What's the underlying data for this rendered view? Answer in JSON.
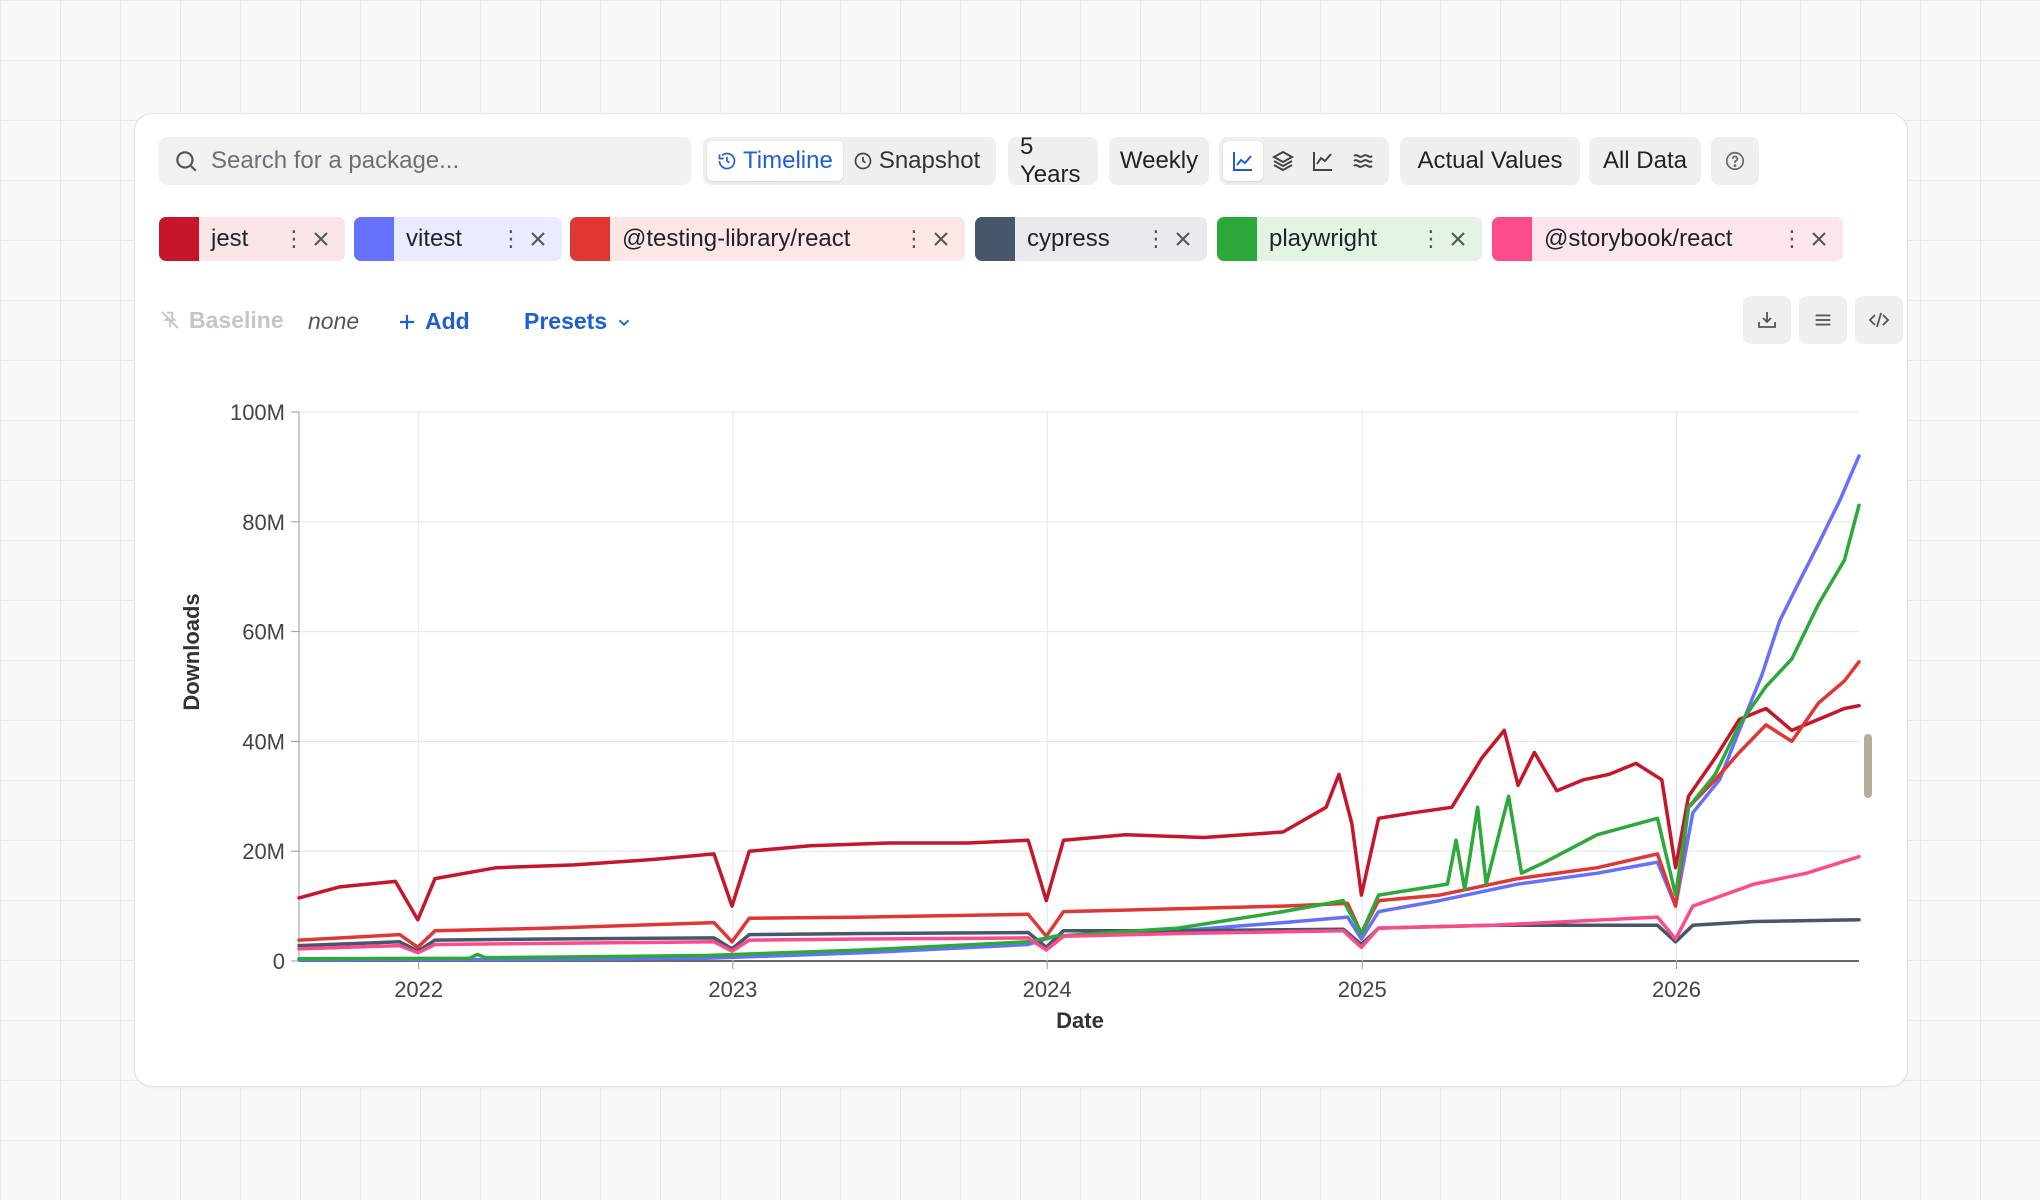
{
  "toolbar": {
    "search_placeholder": "Search for a package...",
    "view_modes": [
      "Timeline",
      "Snapshot"
    ],
    "active_view": "Timeline",
    "range": "5 Years",
    "interval": "Weekly",
    "chart_types": [
      "line-chart-icon",
      "stacked-layers-icon",
      "trend-chart-icon",
      "wave-icon"
    ],
    "active_chart_type": "line-chart-icon",
    "values_mode": "Actual Values",
    "data_mode": "All Data"
  },
  "packages": [
    {
      "name": "jest",
      "color": "#c5162a",
      "bg": "#f9e4e6"
    },
    {
      "name": "vitest",
      "color": "#6571fb",
      "bg": "#e9ebff"
    },
    {
      "name": "@testing-library/react",
      "color": "#e03634",
      "bg": "#fce6e6"
    },
    {
      "name": "cypress",
      "color": "#48566b",
      "bg": "#e8eaee"
    },
    {
      "name": "playwright",
      "color": "#2da83a",
      "bg": "#e3f4e5"
    },
    {
      "name": "@storybook/react",
      "color": "#fb4b8b",
      "bg": "#fde5ee"
    }
  ],
  "controls": {
    "baseline_label": "Baseline",
    "baseline_value": "none",
    "add_label": "Add",
    "presets_label": "Presets"
  },
  "chart_data": {
    "type": "line",
    "xlabel": "Date",
    "ylabel": "Downloads",
    "x_range": [
      "2021-08-15",
      "2026-08-01"
    ],
    "ylim": [
      0,
      100000000
    ],
    "y_ticks": [
      "0",
      "20M",
      "40M",
      "60M",
      "80M",
      "100M"
    ],
    "x_ticks": [
      "2022",
      "2023",
      "2024",
      "2025",
      "2026"
    ],
    "grid": true,
    "series": [
      {
        "name": "jest",
        "color": "#c5162a",
        "points": [
          [
            "2021-08-15",
            11.5
          ],
          [
            "2021-10-01",
            13.5
          ],
          [
            "2021-12-05",
            14.5
          ],
          [
            "2021-12-31",
            7.5
          ],
          [
            "2022-01-20",
            15
          ],
          [
            "2022-04-01",
            17
          ],
          [
            "2022-07-01",
            17.5
          ],
          [
            "2022-10-01",
            18.5
          ],
          [
            "2022-12-10",
            19.5
          ],
          [
            "2022-12-31",
            10
          ],
          [
            "2023-01-20",
            20
          ],
          [
            "2023-04-01",
            21
          ],
          [
            "2023-07-01",
            21.5
          ],
          [
            "2023-10-01",
            21.5
          ],
          [
            "2023-12-10",
            22
          ],
          [
            "2023-12-31",
            11
          ],
          [
            "2024-01-20",
            22
          ],
          [
            "2024-04-01",
            23
          ],
          [
            "2024-07-01",
            22.5
          ],
          [
            "2024-10-01",
            23.5
          ],
          [
            "2024-11-20",
            28
          ],
          [
            "2024-12-05",
            34
          ],
          [
            "2024-12-20",
            25
          ],
          [
            "2024-12-31",
            12
          ],
          [
            "2025-01-20",
            26
          ],
          [
            "2025-03-01",
            27
          ],
          [
            "2025-04-15",
            28
          ],
          [
            "2025-05-20",
            37
          ],
          [
            "2025-06-15",
            42
          ],
          [
            "2025-07-01",
            32
          ],
          [
            "2025-07-20",
            38
          ],
          [
            "2025-08-15",
            31
          ],
          [
            "2025-09-15",
            33
          ],
          [
            "2025-10-15",
            34
          ],
          [
            "2025-11-15",
            36
          ],
          [
            "2025-12-15",
            33
          ],
          [
            "2025-12-31",
            17
          ],
          [
            "2026-01-15",
            30
          ],
          [
            "2026-02-15",
            37
          ],
          [
            "2026-03-15",
            44
          ],
          [
            "2026-04-15",
            46
          ],
          [
            "2026-05-15",
            42
          ],
          [
            "2026-06-15",
            44
          ],
          [
            "2026-07-15",
            46
          ],
          [
            "2026-08-01",
            46.5
          ]
        ]
      },
      {
        "name": "vitest",
        "color": "#6571fb",
        "points": [
          [
            "2021-08-15",
            0.2
          ],
          [
            "2022-06-01",
            0.3
          ],
          [
            "2022-12-01",
            0.5
          ],
          [
            "2023-06-01",
            1.5
          ],
          [
            "2023-12-10",
            3
          ],
          [
            "2024-01-10",
            4.5
          ],
          [
            "2024-06-01",
            5.5
          ],
          [
            "2024-10-01",
            7
          ],
          [
            "2024-12-15",
            8
          ],
          [
            "2024-12-31",
            4
          ],
          [
            "2025-01-20",
            9
          ],
          [
            "2025-04-01",
            11
          ],
          [
            "2025-07-01",
            14
          ],
          [
            "2025-10-01",
            16
          ],
          [
            "2025-12-10",
            18
          ],
          [
            "2025-12-31",
            10
          ],
          [
            "2026-01-20",
            27
          ],
          [
            "2026-02-20",
            33
          ],
          [
            "2026-03-15",
            42
          ],
          [
            "2026-04-10",
            52
          ],
          [
            "2026-05-01",
            62
          ],
          [
            "2026-05-20",
            68
          ],
          [
            "2026-06-15",
            76
          ],
          [
            "2026-07-10",
            84
          ],
          [
            "2026-08-01",
            92
          ]
        ]
      },
      {
        "name": "@testing-library/react",
        "color": "#e03634",
        "points": [
          [
            "2021-08-15",
            3.8
          ],
          [
            "2021-12-10",
            4.8
          ],
          [
            "2021-12-31",
            2.5
          ],
          [
            "2022-01-20",
            5.5
          ],
          [
            "2022-06-01",
            6
          ],
          [
            "2022-12-10",
            7
          ],
          [
            "2022-12-31",
            3.5
          ],
          [
            "2023-01-20",
            7.8
          ],
          [
            "2023-06-01",
            8
          ],
          [
            "2023-12-10",
            8.5
          ],
          [
            "2023-12-31",
            4.5
          ],
          [
            "2024-01-20",
            9
          ],
          [
            "2024-06-01",
            9.5
          ],
          [
            "2024-10-01",
            10
          ],
          [
            "2024-12-15",
            10.5
          ],
          [
            "2024-12-31",
            5
          ],
          [
            "2025-01-20",
            11
          ],
          [
            "2025-04-01",
            12
          ],
          [
            "2025-07-01",
            15
          ],
          [
            "2025-10-01",
            17
          ],
          [
            "2025-12-10",
            19.5
          ],
          [
            "2025-12-31",
            10
          ],
          [
            "2026-01-15",
            28
          ],
          [
            "2026-02-15",
            33
          ],
          [
            "2026-03-15",
            38
          ],
          [
            "2026-04-15",
            43
          ],
          [
            "2026-05-15",
            40
          ],
          [
            "2026-06-15",
            47
          ],
          [
            "2026-07-15",
            51
          ],
          [
            "2026-08-01",
            54.5
          ]
        ]
      },
      {
        "name": "cypress",
        "color": "#48566b",
        "points": [
          [
            "2021-08-15",
            2.8
          ],
          [
            "2021-12-10",
            3.5
          ],
          [
            "2021-12-31",
            1.8
          ],
          [
            "2022-01-20",
            3.8
          ],
          [
            "2022-06-01",
            4
          ],
          [
            "2022-12-10",
            4.2
          ],
          [
            "2022-12-31",
            2.2
          ],
          [
            "2023-01-20",
            4.8
          ],
          [
            "2023-06-01",
            5
          ],
          [
            "2023-12-10",
            5.2
          ],
          [
            "2023-12-31",
            2.5
          ],
          [
            "2024-01-20",
            5.5
          ],
          [
            "2024-06-01",
            5.5
          ],
          [
            "2024-12-10",
            5.8
          ],
          [
            "2024-12-31",
            3
          ],
          [
            "2025-01-20",
            6
          ],
          [
            "2025-06-01",
            6.5
          ],
          [
            "2025-12-10",
            6.5
          ],
          [
            "2025-12-31",
            3.5
          ],
          [
            "2026-01-20",
            6.5
          ],
          [
            "2026-04-01",
            7.2
          ],
          [
            "2026-08-01",
            7.5
          ]
        ]
      },
      {
        "name": "playwright",
        "color": "#2da83a",
        "points": [
          [
            "2021-08-15",
            0.4
          ],
          [
            "2022-03-01",
            0.5
          ],
          [
            "2022-03-10",
            1.2
          ],
          [
            "2022-03-20",
            0.6
          ],
          [
            "2022-12-01",
            1
          ],
          [
            "2023-06-01",
            2
          ],
          [
            "2023-12-10",
            3.5
          ],
          [
            "2024-01-10",
            4.5
          ],
          [
            "2024-06-01",
            6
          ],
          [
            "2024-10-01",
            9
          ],
          [
            "2024-12-10",
            11
          ],
          [
            "2024-12-31",
            5
          ],
          [
            "2025-01-20",
            12
          ],
          [
            "2025-03-01",
            13
          ],
          [
            "2025-04-10",
            14
          ],
          [
            "2025-04-20",
            22
          ],
          [
            "2025-04-30",
            13
          ],
          [
            "2025-05-15",
            28
          ],
          [
            "2025-05-25",
            14
          ],
          [
            "2025-06-20",
            30
          ],
          [
            "2025-07-05",
            16
          ],
          [
            "2025-08-01",
            18
          ],
          [
            "2025-10-01",
            23
          ],
          [
            "2025-12-10",
            26
          ],
          [
            "2025-12-31",
            12
          ],
          [
            "2026-01-15",
            28
          ],
          [
            "2026-02-15",
            34
          ],
          [
            "2026-03-15",
            43
          ],
          [
            "2026-04-15",
            50
          ],
          [
            "2026-05-15",
            55
          ],
          [
            "2026-06-15",
            65
          ],
          [
            "2026-07-15",
            73
          ],
          [
            "2026-08-01",
            83
          ]
        ]
      },
      {
        "name": "@storybook/react",
        "color": "#fb4b8b",
        "points": [
          [
            "2021-08-15",
            2.2
          ],
          [
            "2021-12-10",
            2.8
          ],
          [
            "2021-12-31",
            1.5
          ],
          [
            "2022-01-20",
            3
          ],
          [
            "2022-06-01",
            3.2
          ],
          [
            "2022-12-10",
            3.5
          ],
          [
            "2022-12-31",
            1.8
          ],
          [
            "2023-01-20",
            3.8
          ],
          [
            "2023-06-01",
            4
          ],
          [
            "2023-12-10",
            4.2
          ],
          [
            "2023-12-31",
            2
          ],
          [
            "2024-01-20",
            4.5
          ],
          [
            "2024-06-01",
            5
          ],
          [
            "2024-12-10",
            5.5
          ],
          [
            "2024-12-31",
            2.5
          ],
          [
            "2025-01-20",
            6
          ],
          [
            "2025-06-01",
            6.5
          ],
          [
            "2025-12-10",
            8
          ],
          [
            "2025-12-31",
            4
          ],
          [
            "2026-01-20",
            10
          ],
          [
            "2026-04-01",
            14
          ],
          [
            "2026-06-01",
            16
          ],
          [
            "2026-08-01",
            19
          ]
        ]
      }
    ]
  }
}
